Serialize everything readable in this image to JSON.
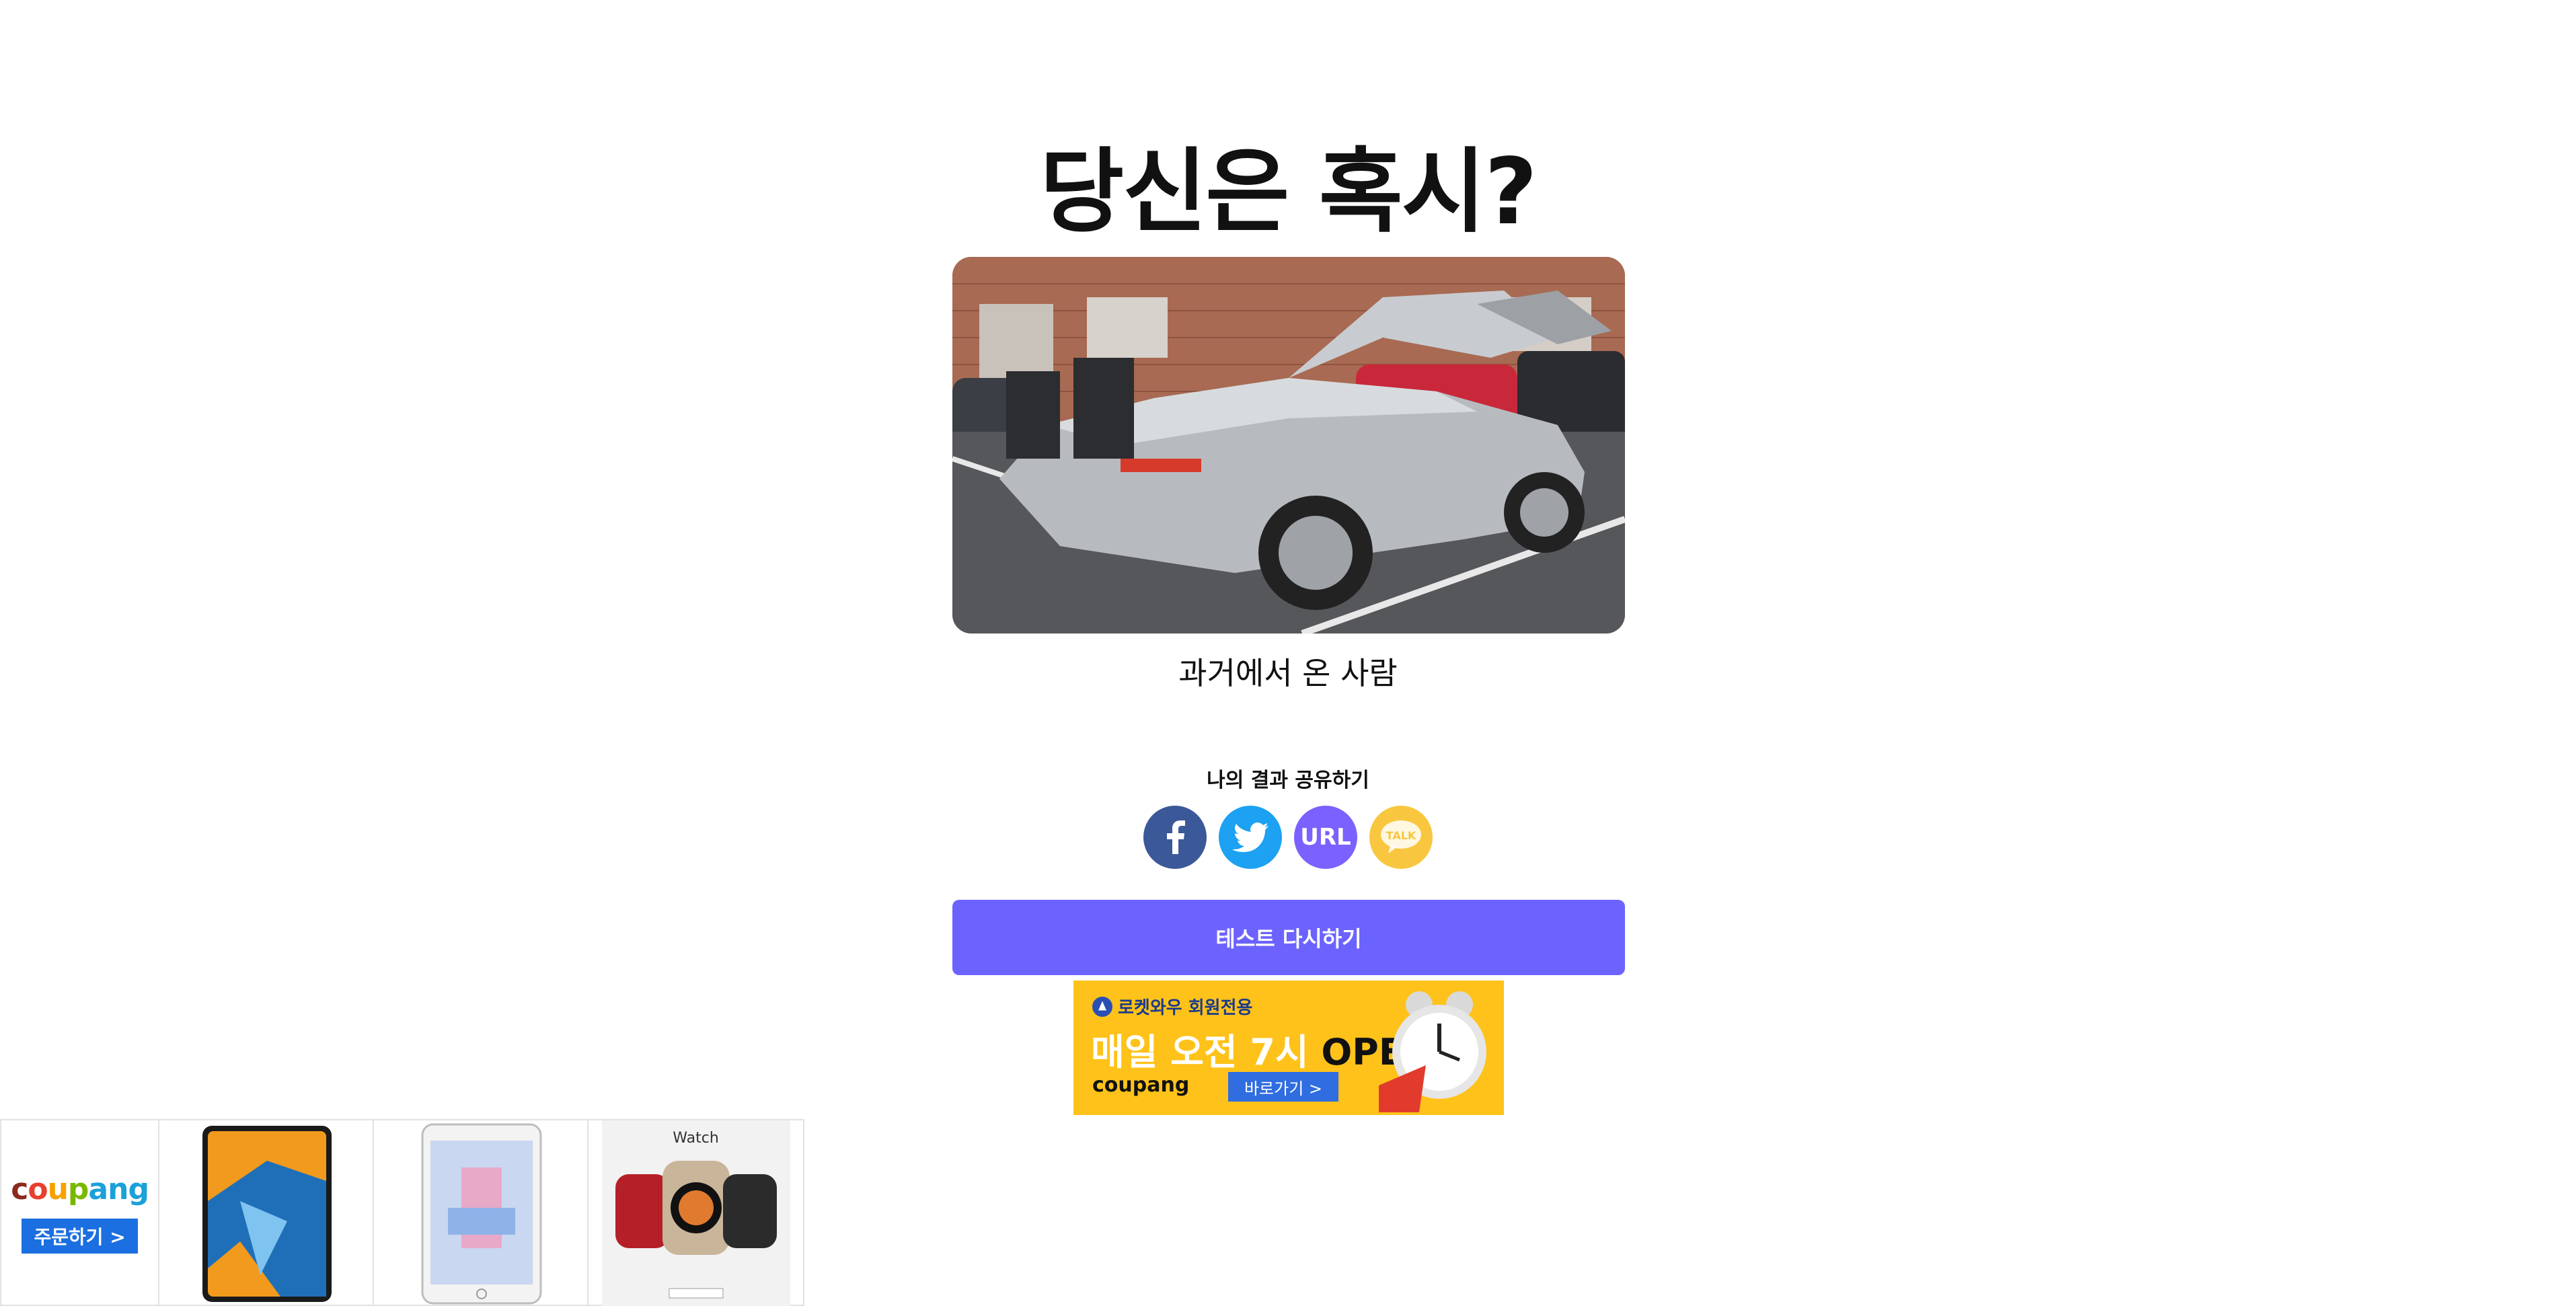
{
  "header": {
    "title": "당신은 혹시?"
  },
  "result": {
    "label": "과거에서 온 사람"
  },
  "share": {
    "label": "나의 결과 공유하기",
    "url_label": "URL",
    "kakao_label": "TALK"
  },
  "actions": {
    "retry_label": "테스트 다시하기"
  },
  "banner_ad": {
    "tagline": "로켓와우 회원전용",
    "headline": "매일 오전 7시",
    "headline_open": "OPEN",
    "brand": "coupang",
    "cta": "바로가기 >"
  },
  "ad_strip": {
    "brand_logo": "coupang",
    "order_button": "주문하기 >",
    "watch_label": "Watch"
  },
  "colors": {
    "facebook": "#3b5998",
    "twitter": "#1da1f2",
    "url": "#7b61ff",
    "kakao": "#f8c73f",
    "retry": "#6c63ff",
    "banner": "#ffc21a"
  }
}
